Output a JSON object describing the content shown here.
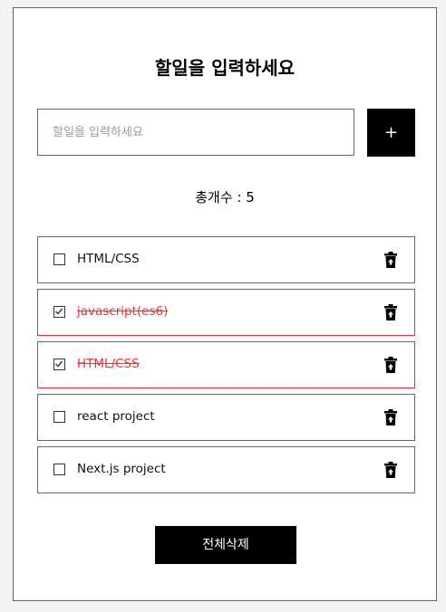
{
  "header": {
    "title": "할일을 입력하세요"
  },
  "input": {
    "placeholder": "할일을 입력하세요",
    "value": ""
  },
  "add_button": {
    "label": "+"
  },
  "counter": {
    "text": "총개수 : 5"
  },
  "todos": [
    {
      "label": "HTML/CSS",
      "done": false
    },
    {
      "label": "javascript(es6)",
      "done": true
    },
    {
      "label": "HTML/CSS",
      "done": true
    },
    {
      "label": "react project",
      "done": false
    },
    {
      "label": "Next.js project",
      "done": false
    }
  ],
  "clear_button": {
    "label": "전체삭제"
  },
  "colors": {
    "done": "#ff2b2b",
    "button_bg": "#000000"
  },
  "icons": {
    "delete": "trash-icon",
    "check": "check-icon"
  }
}
